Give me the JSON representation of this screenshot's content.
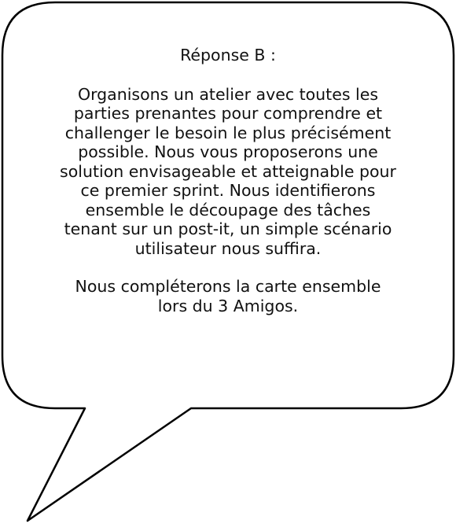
{
  "bubble": {
    "title": "Réponse B :",
    "paragraphs": [
      {
        "lines": [
          "Organisons un atelier avec toutes les",
          "parties prenantes pour comprendre et",
          "challenger le besoin le plus précisément",
          "possible. Nous vous proposerons une",
          "solution envisageable et atteignable pour",
          "ce premier sprint. Nous identifierons",
          "ensemble le découpage des tâches",
          "tenant sur un post-it, un simple scénario",
          "utilisateur nous suffira."
        ]
      },
      {
        "lines": [
          "Nous compléterons la carte ensemble",
          "lors du 3 Amigos."
        ]
      }
    ],
    "colors": {
      "outline": "#000000",
      "fill": "#ffffff",
      "text": "#111111"
    }
  }
}
